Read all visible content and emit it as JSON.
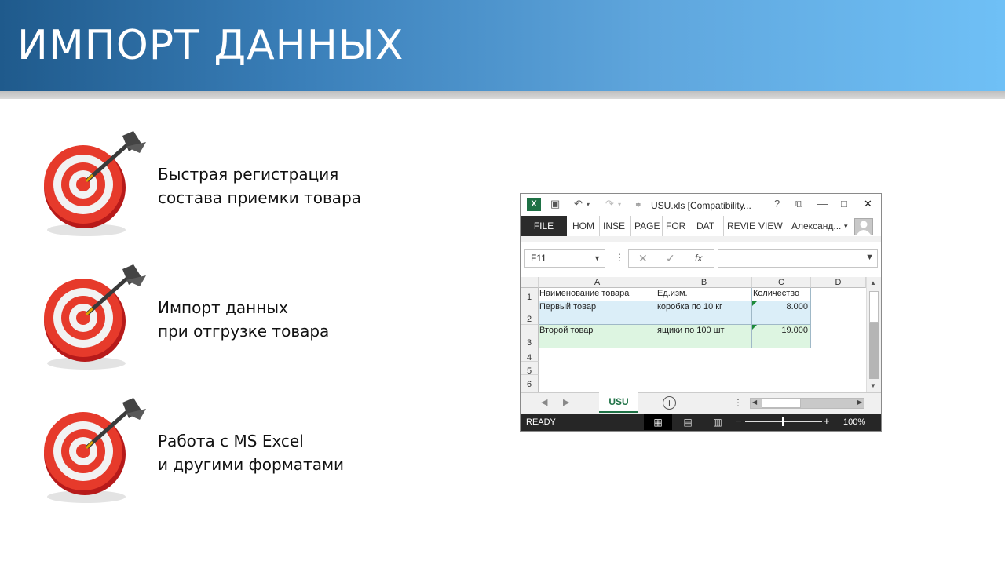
{
  "slide": {
    "title": "ИМПОРТ ДАННЫХ",
    "features": [
      {
        "line1": "Быстрая регистрация",
        "line2": "состава приемки товара",
        "icon": "dart-target-icon"
      },
      {
        "line1": "Импорт данных",
        "line2": "при отгрузке товара",
        "icon": "dart-target-icon"
      },
      {
        "line1": "Работа с MS Excel",
        "line2": "и другими форматами",
        "icon": "dart-target-icon"
      }
    ]
  },
  "excel": {
    "title": "USU.xls  [Compatibility...",
    "logo": "X",
    "titlebar_icons": {
      "help": "?",
      "restore": "⧉",
      "minimize": "—",
      "maximize": "□",
      "close": "✕"
    },
    "ribbon": {
      "file": "FILE",
      "tabs": [
        "HOM",
        "INSE",
        "PAGE",
        "FOR",
        "DAT",
        "REVIE",
        "VIEW"
      ],
      "user": "Александ...",
      "user_caret": "▾"
    },
    "name_box": "F11",
    "formula_buttons": {
      "cancel": "✕",
      "enter": "✓",
      "fx": "fx"
    },
    "columns": [
      "A",
      "B",
      "C",
      "D"
    ],
    "rows": [
      "1",
      "2",
      "3",
      "4",
      "5",
      "6"
    ],
    "cells": {
      "header": [
        "Наименование товара",
        "Ед.изм.",
        "Количество"
      ],
      "row2": [
        "Первый товар",
        "коробка по 10 кг",
        "8.000"
      ],
      "row3": [
        "Второй товар",
        "ящики по 100 шт",
        "19.000"
      ]
    },
    "sheet_tab": "USU",
    "add_sheet": "+",
    "status": "READY",
    "zoom_level": "100%",
    "colors": {
      "excel_green": "#1e7145",
      "row_blue": "#dbeef8",
      "row_green": "#ddf5e1"
    }
  }
}
